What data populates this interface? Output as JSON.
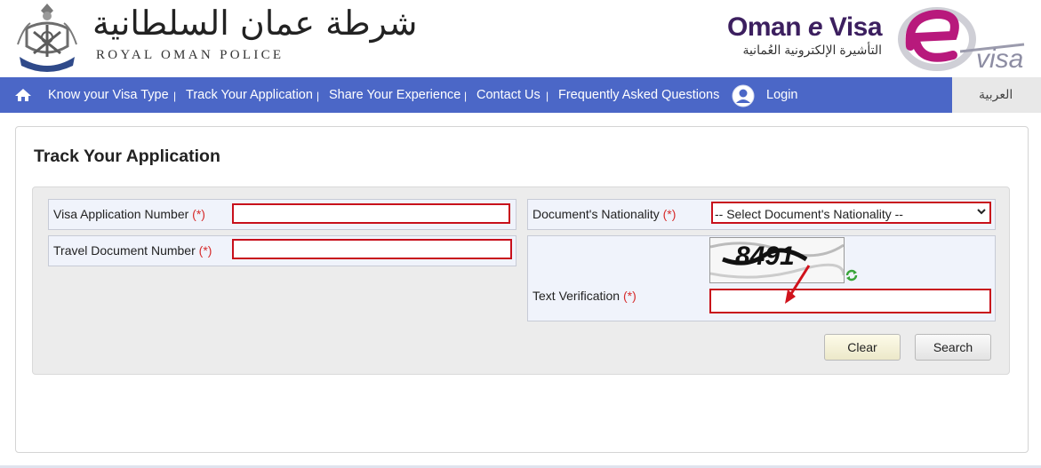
{
  "header": {
    "rop_arabic": "شرطة عمان السلطانية",
    "rop_english": "ROYAL OMAN POLICE",
    "brand_title_1": "Oman ",
    "brand_title_e": "e",
    "brand_title_2": " Visa",
    "brand_arabic": "التأشيرة الإلكترونية العُمانية",
    "evisa_logo_text": "visa"
  },
  "nav": {
    "home_icon": "home-icon",
    "items": [
      {
        "label": "Know your Visa Type"
      },
      {
        "label": "Track Your Application"
      },
      {
        "label": "Share Your Experience"
      },
      {
        "label": "Contact Us"
      },
      {
        "label": "Frequently Asked Questions"
      }
    ],
    "separator": "|",
    "login_label": "Login",
    "language_label": "العربية"
  },
  "page": {
    "title": "Track Your Application"
  },
  "form": {
    "visa_app_label": "Visa Application Number",
    "visa_app_value": "",
    "travel_doc_label": "Travel Document Number",
    "travel_doc_value": "",
    "nationality_label": "Document's Nationality",
    "nationality_selected": "-- Select Document's Nationality --",
    "text_verification_label": "Text Verification",
    "text_verification_value": "",
    "required_mark": "(*)",
    "captcha_text": "8491",
    "clear_label": "Clear",
    "search_label": "Search"
  },
  "colors": {
    "nav_bg": "#4b67c7",
    "highlight_border": "#c8101b",
    "brand_purple": "#3c1f5f",
    "brand_magenta": "#b8197c"
  }
}
